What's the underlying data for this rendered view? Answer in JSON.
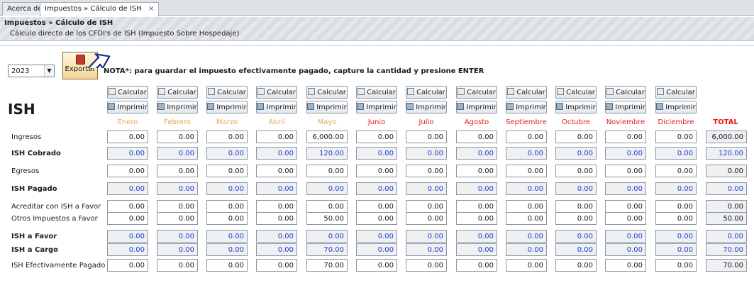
{
  "tabs": [
    {
      "label": "Acerca de",
      "close": ""
    },
    {
      "label": "Impuestos » Cálculo de ISH",
      "close": "×"
    }
  ],
  "header": {
    "title": "Impuestos » Cálculo de ISH",
    "subtitle": "Cálculo directo de los CFDI's de ISH (Impuesto Sobre Hospedaje)"
  },
  "toolbar": {
    "year": "2023",
    "export_label": "Exportar",
    "nota": "NOTA*: para guardar el impuesto efectivamente pagado, capture la cantidad y presione ENTER"
  },
  "section_title": "ISH",
  "buttons": {
    "calcular": "Calcular",
    "imprimir": "Imprimir"
  },
  "months": [
    "Enero",
    "Febrero",
    "Marzo",
    "Abril",
    "Mayo",
    "Junio",
    "Julio",
    "Agosto",
    "Septiembre",
    "Octubre",
    "Noviembre",
    "Diciembre"
  ],
  "total_label": "TOTAL",
  "colors": {
    "future_month": "#e61a1a",
    "past_month": "#e8a64a",
    "total": "#e61a1a",
    "computed_value": "#1f3fd1"
  },
  "rows": [
    {
      "label": "Ingresos",
      "bold": false,
      "blue": false,
      "values": [
        "0.00",
        "0.00",
        "0.00",
        "0.00",
        "6,000.00",
        "0.00",
        "0.00",
        "0.00",
        "0.00",
        "0.00",
        "0.00",
        "0.00"
      ],
      "total": "6,000.00"
    },
    {
      "label": "ISH Cobrado",
      "bold": true,
      "blue": true,
      "values": [
        "0.00",
        "0.00",
        "0.00",
        "0.00",
        "120.00",
        "0.00",
        "0.00",
        "0.00",
        "0.00",
        "0.00",
        "0.00",
        "0.00"
      ],
      "total": "120.00"
    },
    {
      "label": "Egresos",
      "bold": false,
      "blue": false,
      "values": [
        "0.00",
        "0.00",
        "0.00",
        "0.00",
        "0.00",
        "0.00",
        "0.00",
        "0.00",
        "0.00",
        "0.00",
        "0.00",
        "0.00"
      ],
      "total": "0.00"
    },
    {
      "label": "ISH Pagado",
      "bold": true,
      "blue": true,
      "values": [
        "0.00",
        "0.00",
        "0.00",
        "0.00",
        "0.00",
        "0.00",
        "0.00",
        "0.00",
        "0.00",
        "0.00",
        "0.00",
        "0.00"
      ],
      "total": "0.00"
    },
    {
      "label": "Acreditar con ISH a Favor",
      "bold": false,
      "blue": false,
      "values": [
        "0.00",
        "0.00",
        "0.00",
        "0.00",
        "0.00",
        "0.00",
        "0.00",
        "0.00",
        "0.00",
        "0.00",
        "0.00",
        "0.00"
      ],
      "total": "0.00"
    },
    {
      "label": "Otros Impuestos a Favor",
      "bold": false,
      "blue": false,
      "values": [
        "0.00",
        "0.00",
        "0.00",
        "0.00",
        "50.00",
        "0.00",
        "0.00",
        "0.00",
        "0.00",
        "0.00",
        "0.00",
        "0.00"
      ],
      "total": "50.00"
    },
    {
      "label": "ISH a Favor",
      "bold": true,
      "blue": true,
      "values": [
        "0.00",
        "0.00",
        "0.00",
        "0.00",
        "0.00",
        "0.00",
        "0.00",
        "0.00",
        "0.00",
        "0.00",
        "0.00",
        "0.00"
      ],
      "total": "0.00"
    },
    {
      "label": "ISH a Cargo",
      "bold": true,
      "blue": true,
      "values": [
        "0.00",
        "0.00",
        "0.00",
        "0.00",
        "70.00",
        "0.00",
        "0.00",
        "0.00",
        "0.00",
        "0.00",
        "0.00",
        "0.00"
      ],
      "total": "70.00"
    },
    {
      "label": "ISH Efectivamente Pagado",
      "bold": false,
      "blue": false,
      "values": [
        "0.00",
        "0.00",
        "0.00",
        "0.00",
        "70.00",
        "0.00",
        "0.00",
        "0.00",
        "0.00",
        "0.00",
        "0.00",
        "0.00"
      ],
      "total": "70.00"
    }
  ],
  "icons": {
    "calculator": "calculator-icon",
    "printer": "printer-icon",
    "export": "pdf-export-icon",
    "dropdown": "chevron-down-icon"
  }
}
